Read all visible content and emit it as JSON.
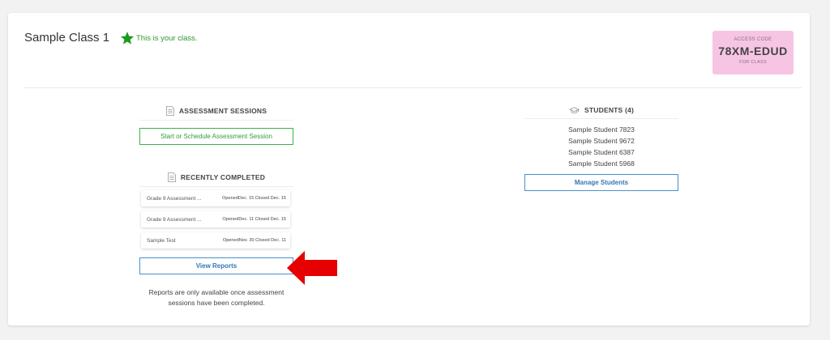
{
  "class": {
    "title": "Sample Class 1",
    "your_class_text": "This is your class."
  },
  "access": {
    "label": "ACCESS CODE",
    "code": "78XM-EDUD",
    "sub": "FOR CLASS"
  },
  "assessment": {
    "heading": "ASSESSMENT SESSIONS",
    "start_button": "Start or Schedule Assessment Session"
  },
  "recent": {
    "heading": "RECENTLY COMPLETED",
    "sessions": [
      {
        "name": "Grade 9 Assessment ...",
        "dates": "OpenedDec. 15 Closed Dec. 15"
      },
      {
        "name": "Grade 9 Assessment ...",
        "dates": "OpenedDec. 11 Closed Dec. 15"
      },
      {
        "name": "Sample Test",
        "dates": "OpenedNov. 30 Closed Dec. 11"
      }
    ],
    "view_reports": "View Reports",
    "note": "Reports are only available once assessment sessions have been completed."
  },
  "students": {
    "heading": "STUDENTS (4)",
    "names": [
      "Sample Student 7823",
      "Sample Student 9672",
      "Sample Student 6387",
      "Sample Student 5968"
    ],
    "manage_button": "Manage Students"
  },
  "colors": {
    "accent_green": "#3bb24a",
    "accent_blue": "#4a90c9",
    "access_bg": "#f7c5e4",
    "arrow_red": "#e60000"
  },
  "icons": {
    "star": "star-icon",
    "document": "document-icon",
    "graduation_cap": "graduation-cap-icon",
    "arrow": "left-arrow-icon"
  }
}
